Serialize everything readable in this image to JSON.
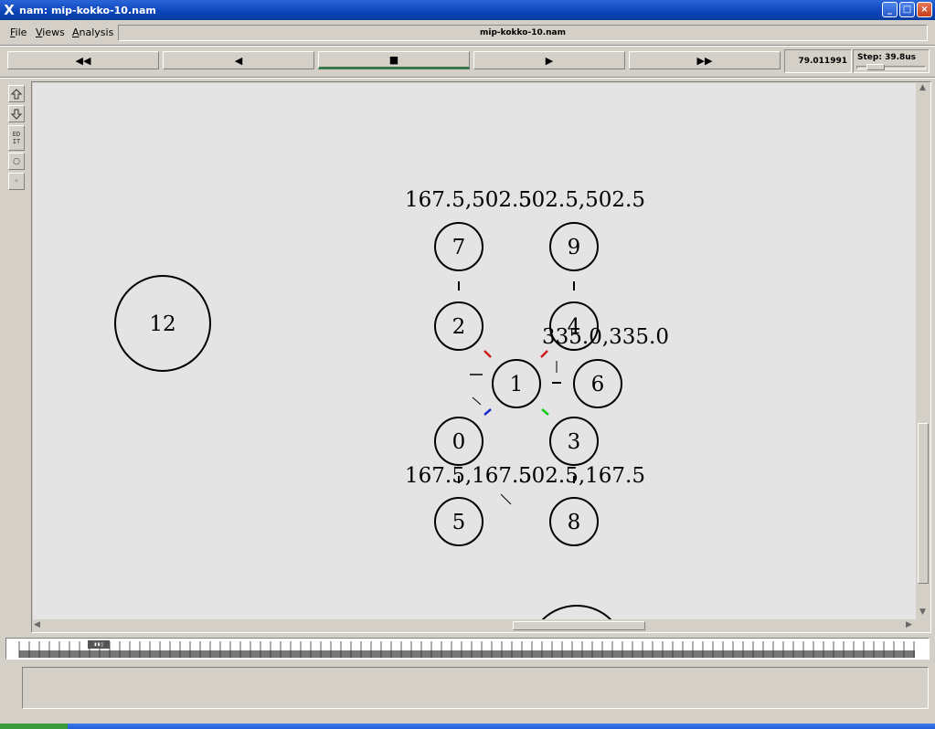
{
  "window": {
    "title": "nam: mip-kokko-10.nam",
    "logo": "X"
  },
  "window_controls": {
    "minimize": "_",
    "maximize": "□",
    "close": "×"
  },
  "menu": {
    "items": [
      "File",
      "Views",
      "Analysis"
    ],
    "filename": "mip-kokko-10.nam"
  },
  "playback": {
    "rewind_fast": "◀◀",
    "rewind": "◀",
    "stop": "■",
    "play": "▶",
    "forward_fast": "▶▶",
    "time": "79.011991",
    "step_label": "Step: 39.8us"
  },
  "tools": {
    "zoom_in": "zoom-in-icon",
    "zoom_out": "zoom-out-icon",
    "edit_label": "ED\nIT",
    "circle1": "○",
    "circle2": "◦"
  },
  "topology": {
    "nodes": [
      {
        "id": "7",
        "label": "7"
      },
      {
        "id": "9",
        "label": "9"
      },
      {
        "id": "2",
        "label": "2"
      },
      {
        "id": "4",
        "label": "4"
      },
      {
        "id": "1",
        "label": "1"
      },
      {
        "id": "6",
        "label": "6"
      },
      {
        "id": "0",
        "label": "0"
      },
      {
        "id": "3",
        "label": "3"
      },
      {
        "id": "5",
        "label": "5"
      },
      {
        "id": "8",
        "label": "8"
      },
      {
        "id": "12",
        "label": "12"
      }
    ],
    "annotations": {
      "top_left": "167.5,502.5",
      "top_right": "502.5,502.5",
      "mid_right": "335.0,335.0",
      "bottom_left": "167.5,167.5",
      "bottom_right": "502.5,167.5"
    },
    "colors": {
      "red": "#cc1a1a",
      "green": "#1acc1a",
      "blue": "#1a2acc"
    }
  },
  "timeline_marker": "▮▮▯"
}
